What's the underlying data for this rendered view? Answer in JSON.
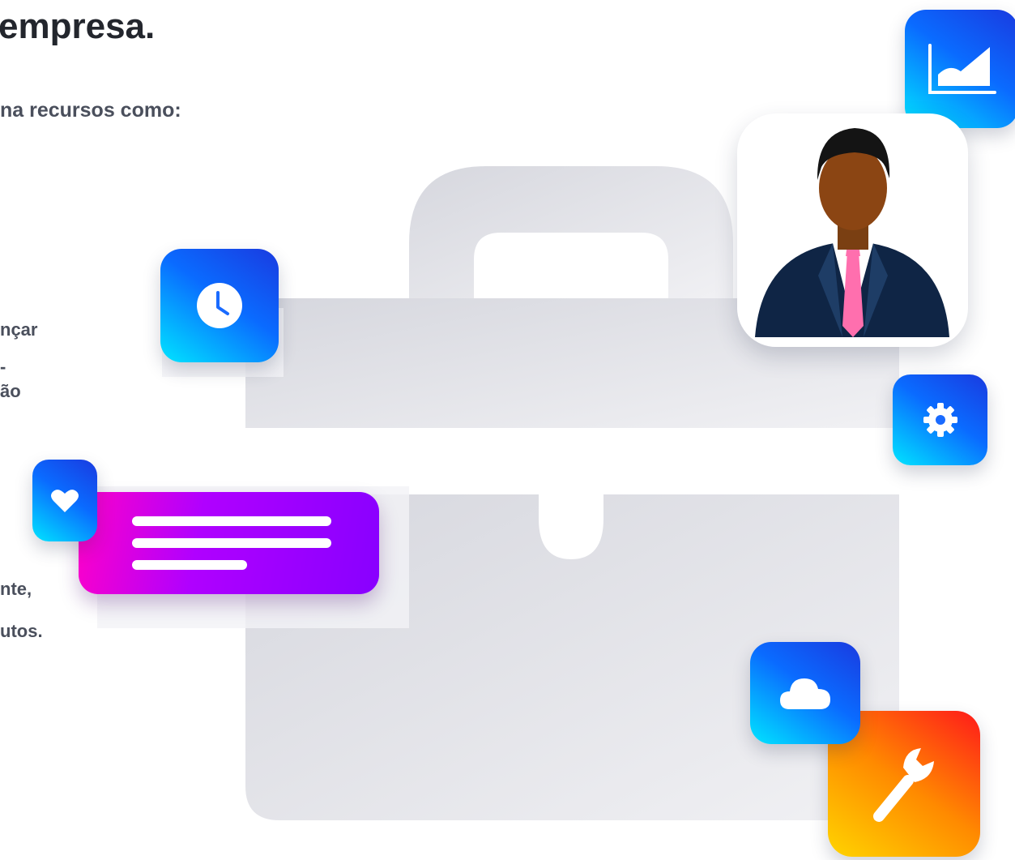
{
  "heading": {
    "title": "empresa."
  },
  "intro": {
    "line1": "na recursos como:"
  },
  "body_fragments": {
    "line1": "nçar",
    "line2": "-",
    "line3": "ão",
    "line4": "nte,",
    "line5": "utos."
  },
  "icons": {
    "chart": "chart-growth-icon",
    "clock": "clock-icon",
    "gear": "gear-icon",
    "heart": "heart-icon",
    "cloud": "cloud-icon",
    "wrench": "wrench-icon",
    "avatar": "businessman-avatar",
    "message": "message-lines-icon"
  },
  "colors": {
    "tile_blue_start": "#00e5ff",
    "tile_blue_end": "#1a3be0",
    "message_start": "#ff00c8",
    "message_end": "#8800ff",
    "wrench_start": "#ffd400",
    "wrench_end": "#ff1a1a",
    "briefcase": "#dcdde3"
  }
}
